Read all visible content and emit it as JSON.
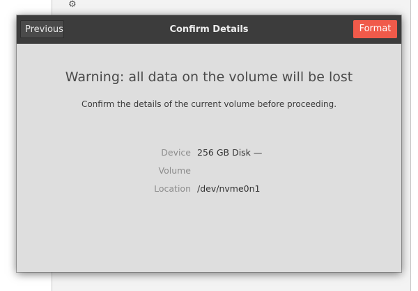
{
  "dialog": {
    "title": "Confirm Details",
    "previous_label": "Previous",
    "format_label": "Format",
    "warning": "Warning: all data on the volume will be lost",
    "subtitle": "Confirm the details of the current volume before proceeding.",
    "details": [
      {
        "label": "Device",
        "value": "256 GB Disk —"
      },
      {
        "label": "Volume",
        "value": ""
      },
      {
        "label": "Location",
        "value": "/dev/nvme0n1"
      }
    ]
  },
  "colors": {
    "header_bg": "#3c3c3c",
    "dialog_bg": "#dedede",
    "destructive_accent": "#f05a4a"
  },
  "background": {
    "icon": "gear-icon"
  }
}
